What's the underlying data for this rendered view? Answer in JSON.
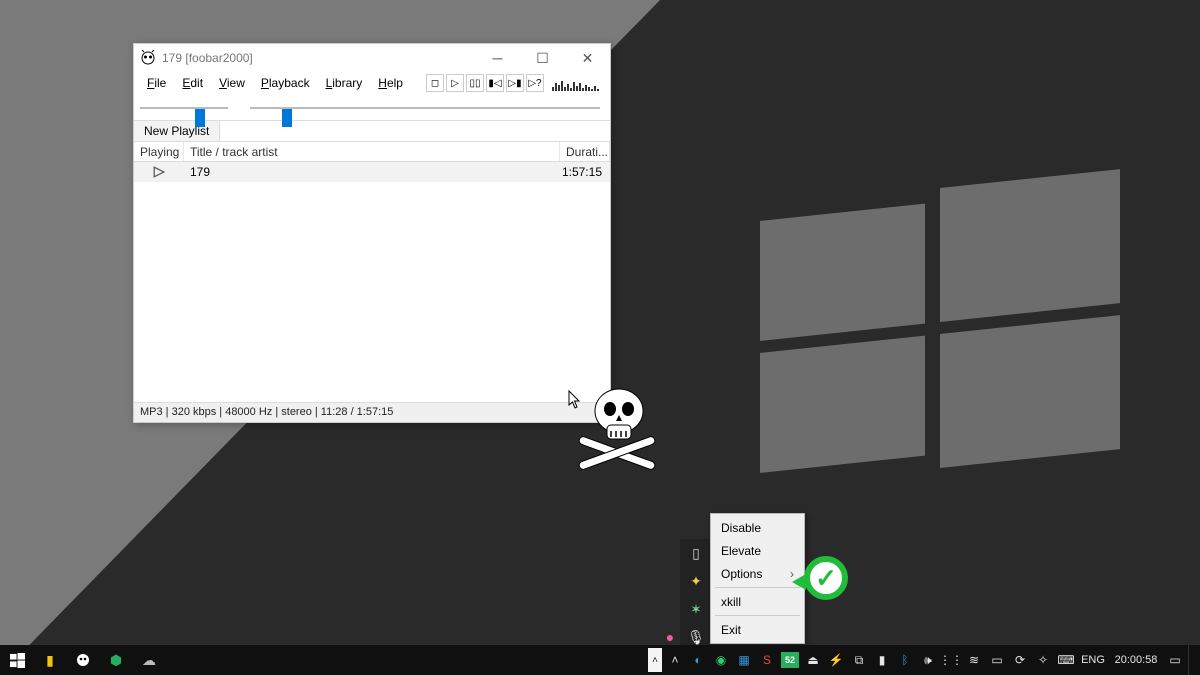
{
  "foobar": {
    "title": "179  [foobar2000]",
    "menu": [
      "File",
      "Edit",
      "View",
      "Playback",
      "Library",
      "Help"
    ],
    "tab": "New Playlist",
    "columns": {
      "playing": "Playing",
      "title": "Title / track artist",
      "duration": "Durati..."
    },
    "rows": [
      {
        "title": "179",
        "duration": "1:57:15"
      }
    ],
    "status": "MP3 | 320 kbps | 48000 Hz | stereo | 11:28 / 1:57:15"
  },
  "context_menu": {
    "items": [
      "Disable",
      "Elevate",
      "Options",
      "xkill",
      "Exit"
    ],
    "submenu_index": 2
  },
  "taskbar": {
    "lang": "ENG",
    "clock": "20:00:58",
    "badge": "52"
  }
}
